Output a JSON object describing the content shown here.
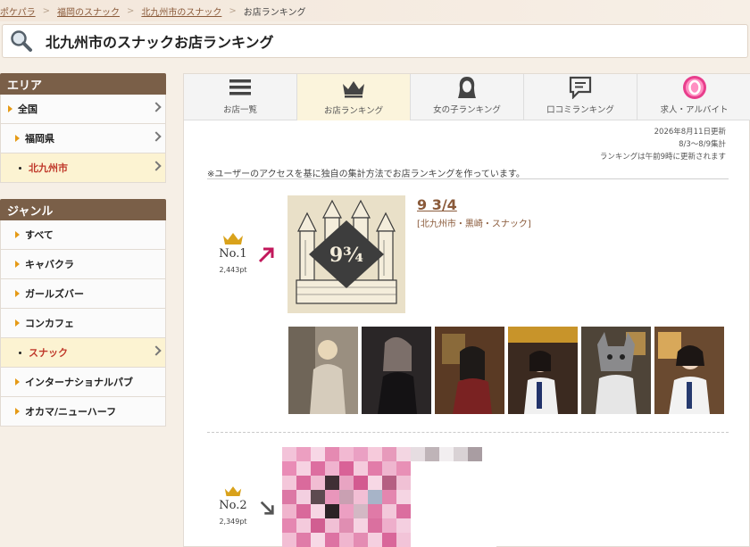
{
  "breadcrumb": {
    "items": [
      "ポケパラ",
      "福岡のスナック",
      "北九州市のスナック",
      "お店ランキング"
    ],
    "sep": ">"
  },
  "search": {
    "title": "北九州市のスナックお店ランキング"
  },
  "sidebar": {
    "area_title": "エリア",
    "area_items": [
      "全国",
      "福岡県",
      "北九州市"
    ],
    "genre_title": "ジャンル",
    "genre_items": [
      "すべて",
      "キャバクラ",
      "ガールズバー",
      "コンカフェ",
      "スナック",
      "インターナショナルパブ",
      "オカマ/ニューハーフ"
    ]
  },
  "tabs": [
    "お店一覧",
    "お店ランキング",
    "女の子ランキング",
    "口コミランキング",
    "求人・アルバイト"
  ],
  "update": {
    "date": "2026年8月11日更新",
    "period": "8/3～8/9集計",
    "schedule": "ランキングは午前9時に更新されます"
  },
  "note": "※ユーザーのアクセスを基に独自の集計方法でお店ランキングを作っています。",
  "ranking": [
    {
      "rank_label": "No.1",
      "points": "2,443pt",
      "trend": "up",
      "name": "9 3/4",
      "meta": "[北九州市・黒崎・スナック]",
      "logo_text": "9¾"
    },
    {
      "rank_label": "No.2",
      "points": "2,349pt",
      "trend": "down"
    }
  ],
  "colors": {
    "sidebar_header": "#7a5f48",
    "active_text": "#c0392b",
    "link_brown": "#8a5a3a",
    "crown_gold": "#d9a21b",
    "up_arrow": "#c2185b"
  }
}
